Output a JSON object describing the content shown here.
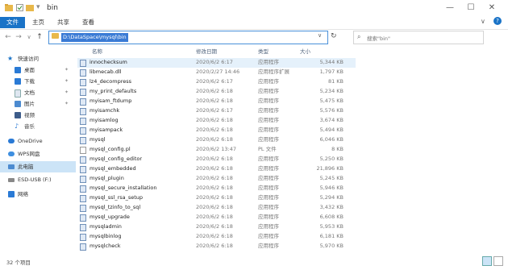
{
  "window": {
    "title": "bin",
    "controls": {
      "minimize": "—",
      "maximize": "☐",
      "close": "✕"
    }
  },
  "ribbon": {
    "tabs": [
      "文件",
      "主页",
      "共享",
      "查看"
    ],
    "active_color": "#1a73c7"
  },
  "nav": {
    "back": "←",
    "forward": "→",
    "recent": "∨",
    "up": "↑",
    "address": "D:\\DataSpace\\mysql\\bin",
    "search_placeholder": "搜索\"bin\""
  },
  "sidebar": {
    "items": [
      {
        "label": "快速访问",
        "icon": "star-icon",
        "pin": false
      },
      {
        "label": "桌面",
        "icon": "desktop-icon",
        "pin": true
      },
      {
        "label": "下载",
        "icon": "download-icon",
        "pin": true
      },
      {
        "label": "文档",
        "icon": "document-icon",
        "pin": true
      },
      {
        "label": "图片",
        "icon": "picture-icon",
        "pin": true
      },
      {
        "label": "视频",
        "icon": "video-icon",
        "pin": false
      },
      {
        "label": "音乐",
        "icon": "music-icon",
        "pin": false
      },
      {
        "label": "OneDrive",
        "icon": "cloud-icon",
        "pin": false
      },
      {
        "label": "WPS网盘",
        "icon": "wps-cloud-icon",
        "pin": false
      },
      {
        "label": "此电脑",
        "icon": "computer-icon",
        "pin": false
      },
      {
        "label": "ESD-USB (F:)",
        "icon": "usb-drive-icon",
        "pin": false
      },
      {
        "label": "网络",
        "icon": "network-icon",
        "pin": false
      }
    ],
    "pin_glyph": "✦"
  },
  "list": {
    "columns": {
      "name": "名称",
      "date": "修改日期",
      "type": "类型",
      "size": "大小"
    },
    "rows": [
      {
        "name": "innochecksum",
        "date": "2020/6/2 6:17",
        "type": "应用程序",
        "size": "5,344 KB"
      },
      {
        "name": "libmecab.dll",
        "date": "2020/2/27 14:46",
        "type": "应用程序扩展",
        "size": "1,797 KB"
      },
      {
        "name": "lz4_decompress",
        "date": "2020/6/2 6:17",
        "type": "应用程序",
        "size": "81 KB"
      },
      {
        "name": "my_print_defaults",
        "date": "2020/6/2 6:18",
        "type": "应用程序",
        "size": "5,234 KB"
      },
      {
        "name": "myisam_ftdump",
        "date": "2020/6/2 6:18",
        "type": "应用程序",
        "size": "5,475 KB"
      },
      {
        "name": "myisamchk",
        "date": "2020/6/2 6:17",
        "type": "应用程序",
        "size": "5,576 KB"
      },
      {
        "name": "myisamlog",
        "date": "2020/6/2 6:18",
        "type": "应用程序",
        "size": "3,674 KB"
      },
      {
        "name": "myisampack",
        "date": "2020/6/2 6:18",
        "type": "应用程序",
        "size": "5,494 KB"
      },
      {
        "name": "mysql",
        "date": "2020/6/2 6:18",
        "type": "应用程序",
        "size": "6,046 KB"
      },
      {
        "name": "mysql_config.pl",
        "date": "2020/6/2 13:47",
        "type": "PL 文件",
        "size": "8 KB"
      },
      {
        "name": "mysql_config_editor",
        "date": "2020/6/2 6:18",
        "type": "应用程序",
        "size": "5,250 KB"
      },
      {
        "name": "mysql_embedded",
        "date": "2020/6/2 6:18",
        "type": "应用程序",
        "size": "21,896 KB"
      },
      {
        "name": "mysql_plugin",
        "date": "2020/6/2 6:18",
        "type": "应用程序",
        "size": "5,245 KB"
      },
      {
        "name": "mysql_secure_installation",
        "date": "2020/6/2 6:18",
        "type": "应用程序",
        "size": "5,946 KB"
      },
      {
        "name": "mysql_ssl_rsa_setup",
        "date": "2020/6/2 6:18",
        "type": "应用程序",
        "size": "5,294 KB"
      },
      {
        "name": "mysql_tzinfo_to_sql",
        "date": "2020/6/2 6:18",
        "type": "应用程序",
        "size": "3,432 KB"
      },
      {
        "name": "mysql_upgrade",
        "date": "2020/6/2 6:18",
        "type": "应用程序",
        "size": "6,608 KB"
      },
      {
        "name": "mysqladmin",
        "date": "2020/6/2 6:18",
        "type": "应用程序",
        "size": "5,953 KB"
      },
      {
        "name": "mysqlbinlog",
        "date": "2020/6/2 6:18",
        "type": "应用程序",
        "size": "6,181 KB"
      },
      {
        "name": "mysqlcheck",
        "date": "2020/6/2 6:18",
        "type": "应用程序",
        "size": "5,970 KB"
      }
    ]
  },
  "status": {
    "item_count": "32 个项目"
  }
}
